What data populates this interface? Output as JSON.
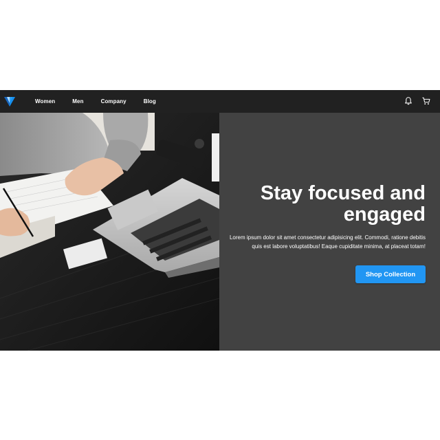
{
  "brand": {
    "logo_icon": "vuetify-logo-icon",
    "accent": "#2196f3"
  },
  "nav": {
    "links": [
      {
        "label": "Women"
      },
      {
        "label": "Men"
      },
      {
        "label": "Company"
      },
      {
        "label": "Blog"
      }
    ],
    "icons": [
      "bell-icon",
      "cart-icon"
    ],
    "background": "#212121"
  },
  "hero": {
    "image_icon": "desk-workspace-photo",
    "headline": "Stay focused and engaged",
    "subtext": "Lorem ipsum dolor sit amet consectetur adipisicing elit. Commodi, ratione debitis quis est labore voluptatibus! Eaque cupiditate minima, at placeat totam!",
    "cta_label": "Shop Collection",
    "panel_color": "#424242"
  }
}
